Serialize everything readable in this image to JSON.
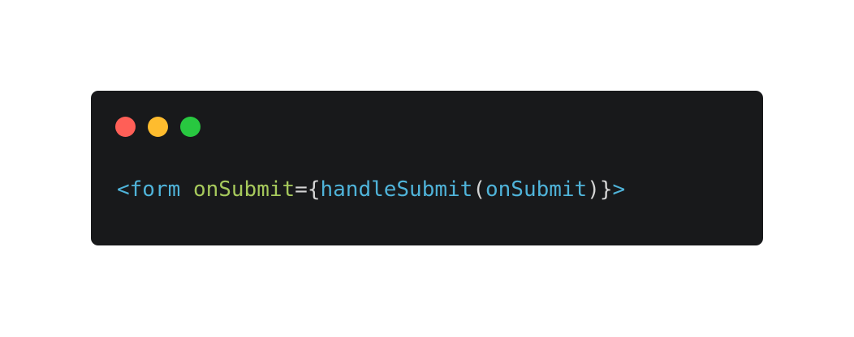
{
  "window": {
    "controls": [
      {
        "name": "close",
        "color": "#ff5f57"
      },
      {
        "name": "minimize",
        "color": "#febc2e"
      },
      {
        "name": "zoom",
        "color": "#28c840"
      }
    ]
  },
  "code": {
    "tokens": [
      {
        "text": "<",
        "color": "#4fb3d9"
      },
      {
        "text": "form",
        "color": "#4fb3d9"
      },
      {
        "text": " ",
        "color": "#d4d4d4"
      },
      {
        "text": "onSubmit",
        "color": "#a6c95c"
      },
      {
        "text": "=",
        "color": "#d4d4d4"
      },
      {
        "text": "{",
        "color": "#d4d4d4"
      },
      {
        "text": "handleSubmit",
        "color": "#4fb3d9"
      },
      {
        "text": "(",
        "color": "#d4d4d4"
      },
      {
        "text": "onSubmit",
        "color": "#4fb3d9"
      },
      {
        "text": ")",
        "color": "#d4d4d4"
      },
      {
        "text": "}",
        "color": "#d4d4d4"
      },
      {
        "text": ">",
        "color": "#4fb3d9"
      }
    ]
  },
  "colors": {
    "window_background": "#18191b",
    "page_background": "#ffffff"
  }
}
